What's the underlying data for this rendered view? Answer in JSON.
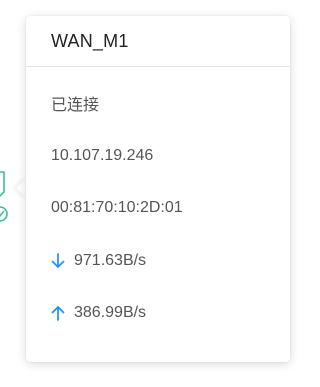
{
  "tooltip": {
    "title": "WAN_M1",
    "status": "已连接",
    "ip_address": "10.107.19.246",
    "mac_address": "00:81:70:10:2D:01",
    "download_speed": "971.63B/s",
    "upload_speed": "386.99B/s"
  },
  "icons": {
    "download": "arrow-down-icon",
    "upload": "arrow-up-icon",
    "device": "port-connected-icon"
  },
  "colors": {
    "accent": "#1890ff",
    "device_green": "#3fbf90",
    "text_primary": "#222222",
    "text_secondary": "#555555"
  }
}
